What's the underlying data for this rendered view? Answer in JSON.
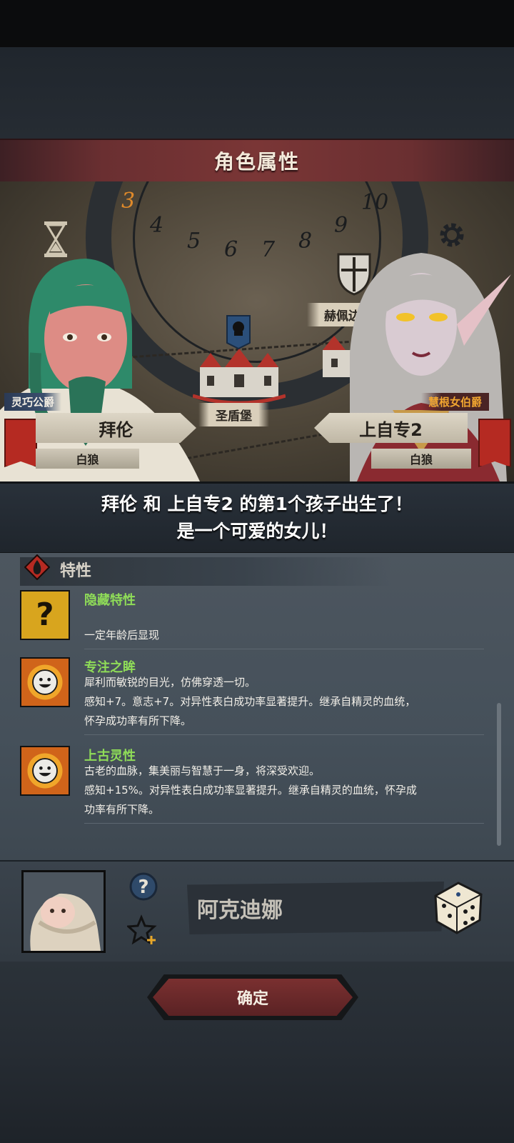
{
  "title": "角色属性",
  "scene": {
    "dial_numbers": [
      "3",
      "4",
      "5",
      "6",
      "7",
      "8",
      "9",
      "10"
    ],
    "current_turn": "3",
    "places": [
      "赫佩边境",
      "圣盾堡"
    ]
  },
  "parents": {
    "left": {
      "title": "灵巧公爵",
      "name": "拜伦",
      "house": "白狼"
    },
    "right": {
      "title": "慧根女伯爵",
      "name": "上自专2",
      "house": "白狼"
    }
  },
  "announcement": {
    "line1": "拜伦 和 上自专2 的第1个孩子出生了！",
    "line2": "是一个可爱的女儿！"
  },
  "traits": {
    "header": "特性",
    "items": [
      {
        "name": "隐藏特性",
        "icon": "question-mark-icon",
        "lines": [
          "一定年龄后显现"
        ]
      },
      {
        "name": "专注之眸",
        "icon": "smiley-sun-icon",
        "lines": [
          "犀利而敏锐的目光，仿佛穿透一切。",
          "感知+7。意志+7。对异性表白成功率显著提升。继承自精灵的血统，",
          "怀孕成功率有所下降。"
        ]
      },
      {
        "name": "上古灵性",
        "icon": "smiley-sun-icon",
        "lines": [
          "古老的血脉，集美丽与智慧于一身，将深受欢迎。",
          "感知+15%。对异性表白成功率显著提升。继承自精灵的血统，怀孕成",
          "功率有所下降。"
        ]
      }
    ]
  },
  "child": {
    "name_value": "阿克迪娜"
  },
  "confirm_label": "确定",
  "colors": {
    "title_banner": "#7a3636",
    "trait_name": "#8fdc58",
    "right_title": "#f0a530",
    "flag": "#b52a22"
  }
}
